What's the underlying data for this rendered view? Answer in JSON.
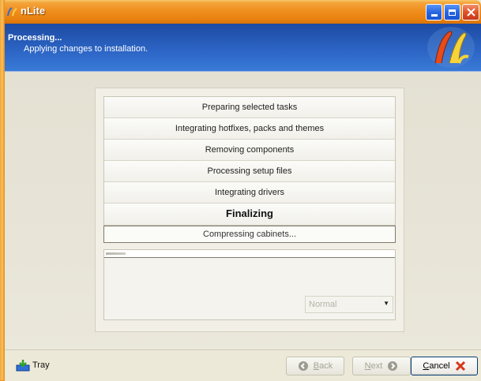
{
  "window": {
    "title": "nLite"
  },
  "header": {
    "title": "Processing...",
    "subtitle": "Applying changes to installation."
  },
  "tasks": [
    {
      "label": "Preparing selected tasks",
      "active": false
    },
    {
      "label": "Integrating hotfixes, packs and themes",
      "active": false
    },
    {
      "label": "Removing components",
      "active": false
    },
    {
      "label": "Processing setup files",
      "active": false
    },
    {
      "label": "Integrating drivers",
      "active": false
    },
    {
      "label": "Finalizing",
      "active": true
    }
  ],
  "status": {
    "text": "Compressing cabinets..."
  },
  "progress": {
    "fraction": 0.07
  },
  "priority": {
    "value": "Normal"
  },
  "footer": {
    "tray_label": "Tray",
    "back_label_u": "B",
    "back_label_rest": "ack",
    "next_label_u": "N",
    "next_label_rest": "ext",
    "cancel_label_u": "C",
    "cancel_label_rest": "ancel"
  },
  "colors": {
    "titlebar": "#f08f1f",
    "header": "#2d66c6",
    "accent_blue": "#2866e2",
    "close_red": "#e0532a"
  }
}
